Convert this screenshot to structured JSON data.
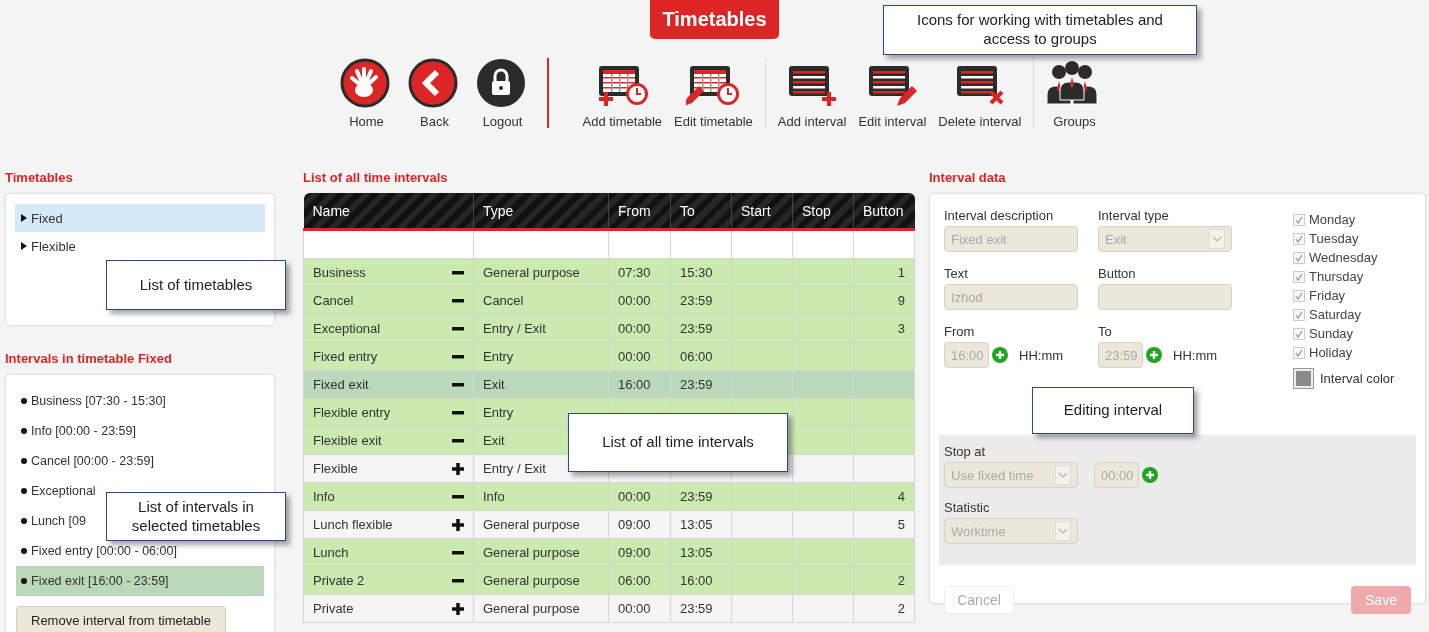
{
  "title": "Timetables",
  "toolbar": {
    "callout": "Icons for working with timetables and access to groups",
    "groups": [
      [
        {
          "kind": "home",
          "label": "Home"
        },
        {
          "kind": "back",
          "label": "Back"
        },
        {
          "kind": "logout",
          "label": "Logout"
        }
      ],
      [
        {
          "kind": "add-timetable",
          "label": "Add timetable"
        },
        {
          "kind": "edit-timetable",
          "label": "Edit timetable"
        }
      ],
      [
        {
          "kind": "add-interval",
          "label": "Add interval"
        },
        {
          "kind": "edit-interval",
          "label": "Edit interval"
        },
        {
          "kind": "delete-interval",
          "label": "Delete interval"
        }
      ],
      [
        {
          "kind": "groups",
          "label": "Groups"
        }
      ]
    ]
  },
  "timetables": {
    "heading": "Timetables",
    "callout": "List of timetables",
    "items": [
      {
        "label": "Fixed",
        "selected": true
      },
      {
        "label": "Flexible",
        "selected": false
      }
    ]
  },
  "intervals": {
    "heading": "Intervals in timetable Fixed",
    "callout": "List of intervals in selected timetables",
    "button": "Remove interval from timetable",
    "items": [
      {
        "label": "Business [07:30 - 15:30]",
        "selected": false
      },
      {
        "label": "Info [00:00 - 23:59]",
        "selected": false
      },
      {
        "label": "Cancel [00:00 - 23:59]",
        "selected": false
      },
      {
        "label": "Exceptional",
        "selected": false
      },
      {
        "label": "Lunch [09",
        "selected": false
      },
      {
        "label": "Fixed entry [00:00 - 06:00]",
        "selected": false
      },
      {
        "label": "Fixed exit [16:00 - 23:59]",
        "selected": true
      }
    ]
  },
  "table": {
    "heading": "List of all time intervals",
    "callout": "List of all time intervals",
    "columns": [
      "Name",
      "Type",
      "From",
      "To",
      "Start",
      "Stop",
      "Button"
    ],
    "rows": [
      {
        "name": "Business",
        "in_timetable": true,
        "selected": false,
        "type": "General purpose",
        "from": "07:30",
        "to": "15:30",
        "button": "1"
      },
      {
        "name": "Cancel",
        "in_timetable": true,
        "selected": false,
        "type": "Cancel",
        "from": "00:00",
        "to": "23:59",
        "button": "9"
      },
      {
        "name": "Exceptional",
        "in_timetable": true,
        "selected": false,
        "type": "Entry / Exit",
        "from": "00:00",
        "to": "23:59",
        "button": "3"
      },
      {
        "name": "Fixed entry",
        "in_timetable": true,
        "selected": false,
        "type": "Entry",
        "from": "00:00",
        "to": "06:00"
      },
      {
        "name": "Fixed exit",
        "in_timetable": true,
        "selected": true,
        "type": "Exit",
        "from": "16:00",
        "to": "23:59"
      },
      {
        "name": "Flexible entry",
        "in_timetable": true,
        "selected": false,
        "type": "Entry"
      },
      {
        "name": "Flexible exit",
        "in_timetable": true,
        "selected": false,
        "type": "Exit"
      },
      {
        "name": "Flexible",
        "in_timetable": false,
        "selected": false,
        "type": "Entry / Exit"
      },
      {
        "name": "Info",
        "in_timetable": true,
        "selected": false,
        "type": "Info",
        "from": "00:00",
        "to": "23:59",
        "button": "4"
      },
      {
        "name": "Lunch flexible",
        "in_timetable": false,
        "selected": false,
        "type": "General purpose",
        "from": "09:00",
        "to": "13:05",
        "button": "5"
      },
      {
        "name": "Lunch",
        "in_timetable": true,
        "selected": false,
        "type": "General purpose",
        "from": "09:00",
        "to": "13:05"
      },
      {
        "name": "Private 2",
        "in_timetable": true,
        "selected": false,
        "type": "General purpose",
        "from": "06:00",
        "to": "16:00",
        "button": "2"
      },
      {
        "name": "Private",
        "in_timetable": false,
        "selected": false,
        "type": "General purpose",
        "from": "00:00",
        "to": "23:59",
        "button": "2"
      }
    ]
  },
  "form": {
    "heading": "Interval data",
    "callout": "Editing interval",
    "description": {
      "label": "Interval description",
      "value": "Fixed exit"
    },
    "interval_type": {
      "label": "Interval type",
      "value": "Exit"
    },
    "text": {
      "label": "Text",
      "value": "Izhod"
    },
    "button": {
      "label": "Button"
    },
    "from": {
      "label": "From",
      "value": "16:00",
      "unit": "HH:mm"
    },
    "to": {
      "label": "To",
      "value": "23:59",
      "unit": "HH:mm"
    },
    "days": [
      {
        "label": "Monday",
        "checked": true
      },
      {
        "label": "Tuesday",
        "checked": true
      },
      {
        "label": "Wednesday",
        "checked": true
      },
      {
        "label": "Thursday",
        "checked": true
      },
      {
        "label": "Friday",
        "checked": true
      },
      {
        "label": "Saturday",
        "checked": true
      },
      {
        "label": "Sunday",
        "checked": true
      },
      {
        "label": "Holiday",
        "checked": true
      }
    ],
    "color_label": "Interval color",
    "stop_at": {
      "label": "Stop at",
      "value": "Use fixed time",
      "time": "00:00"
    },
    "statistic": {
      "label": "Statistic",
      "value": "Worktime"
    },
    "cancel": "Cancel",
    "save": "Save"
  }
}
